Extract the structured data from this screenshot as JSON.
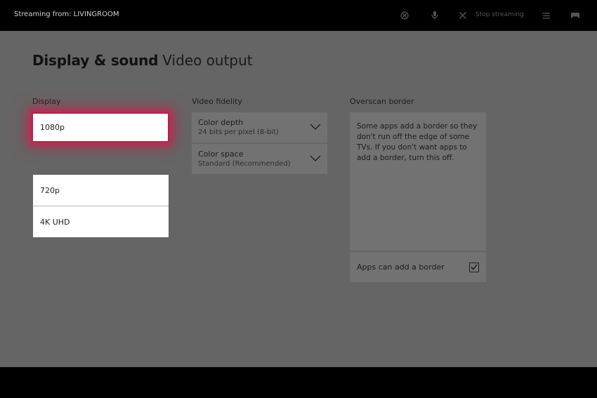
{
  "header": {
    "streaming_label": "Streaming from: LIVINGROOM",
    "stop_streaming_label": "Stop streaming",
    "icons": [
      "xbox-icon",
      "microphone-icon",
      "close-icon",
      "menu-icon",
      "controller-icon"
    ]
  },
  "page": {
    "title": "Display & sound",
    "subtitle": "Video output"
  },
  "display": {
    "label": "Display",
    "options": [
      "1080p",
      "720p",
      "4K UHD"
    ],
    "selected": "1080p"
  },
  "video_fidelity": {
    "label": "Video fidelity",
    "color_depth": {
      "label": "Color depth",
      "value": "24 bits per pixel (8-bit)"
    },
    "color_space": {
      "label": "Color space",
      "value": "Standard (Recommended)"
    }
  },
  "overscan": {
    "label": "Overscan border",
    "description": "Some apps add a border so they don't run off the edge of some TVs. If you don't want apps to add a border, turn this off.",
    "toggle_label": "Apps can add a border",
    "toggle_checked": true
  },
  "colors": {
    "focus_highlight": "#c21d4a",
    "dim_background": "#656565",
    "bar_background": "#000000"
  }
}
